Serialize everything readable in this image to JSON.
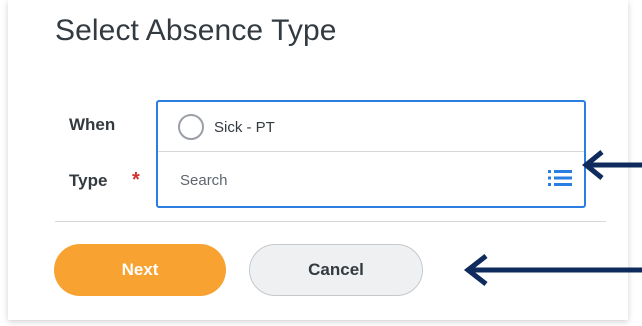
{
  "dialog": {
    "title": "Select Absence Type"
  },
  "form": {
    "when_label": "When",
    "type_label": "Type",
    "required_marker": "*",
    "selected_option": "Sick - PT",
    "search_placeholder": "Search",
    "list_icon": "list-icon"
  },
  "actions": {
    "next_label": "Next",
    "cancel_label": "Cancel"
  },
  "colors": {
    "accent_blue": "#2a7de1",
    "next_orange": "#f7a231",
    "required_red": "#d32f2f",
    "arrow_navy": "#0f2a5c"
  },
  "annotations": {
    "arrow_icons": [
      "arrow-left-icon",
      "arrow-left-icon"
    ]
  }
}
